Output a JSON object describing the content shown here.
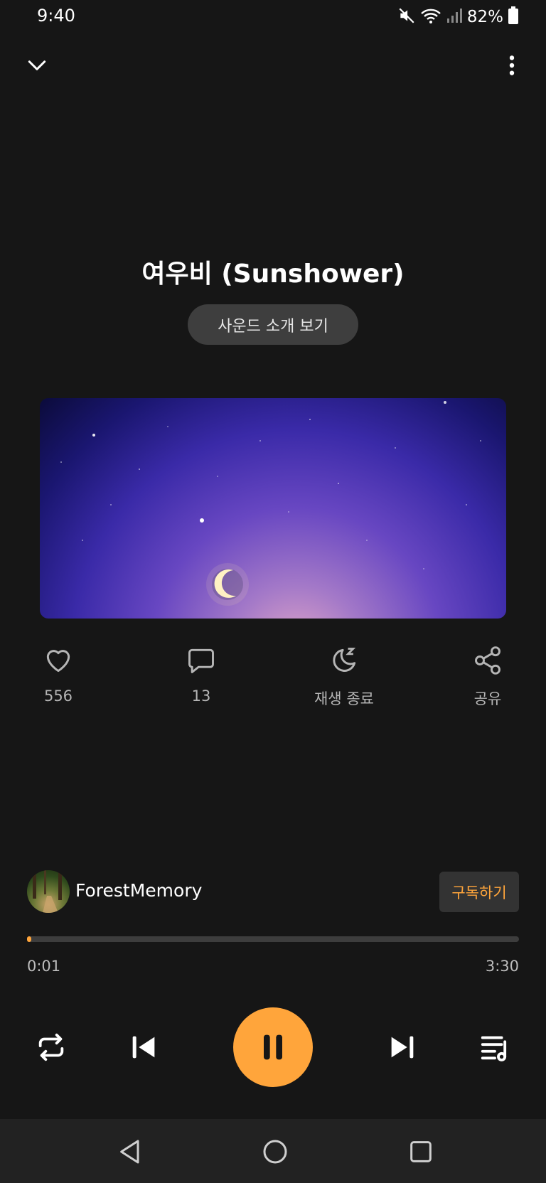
{
  "status": {
    "time": "9:40",
    "battery": "82%"
  },
  "track": {
    "title": "여우비 (Sunshower)",
    "intro_button": "사운드 소개 보기"
  },
  "actions": [
    {
      "label": "556",
      "icon": "heart-icon"
    },
    {
      "label": "13",
      "icon": "comment-icon"
    },
    {
      "label": "재생 종료",
      "icon": "sleep-timer-icon"
    },
    {
      "label": "공유",
      "icon": "share-icon"
    }
  ],
  "channel": {
    "name": "ForestMemory",
    "subscribe_label": "구독하기"
  },
  "playback": {
    "current": "0:01",
    "total": "3:30",
    "progress": 0.005
  },
  "colors": {
    "accent": "#ffa53b",
    "background": "#161616"
  }
}
